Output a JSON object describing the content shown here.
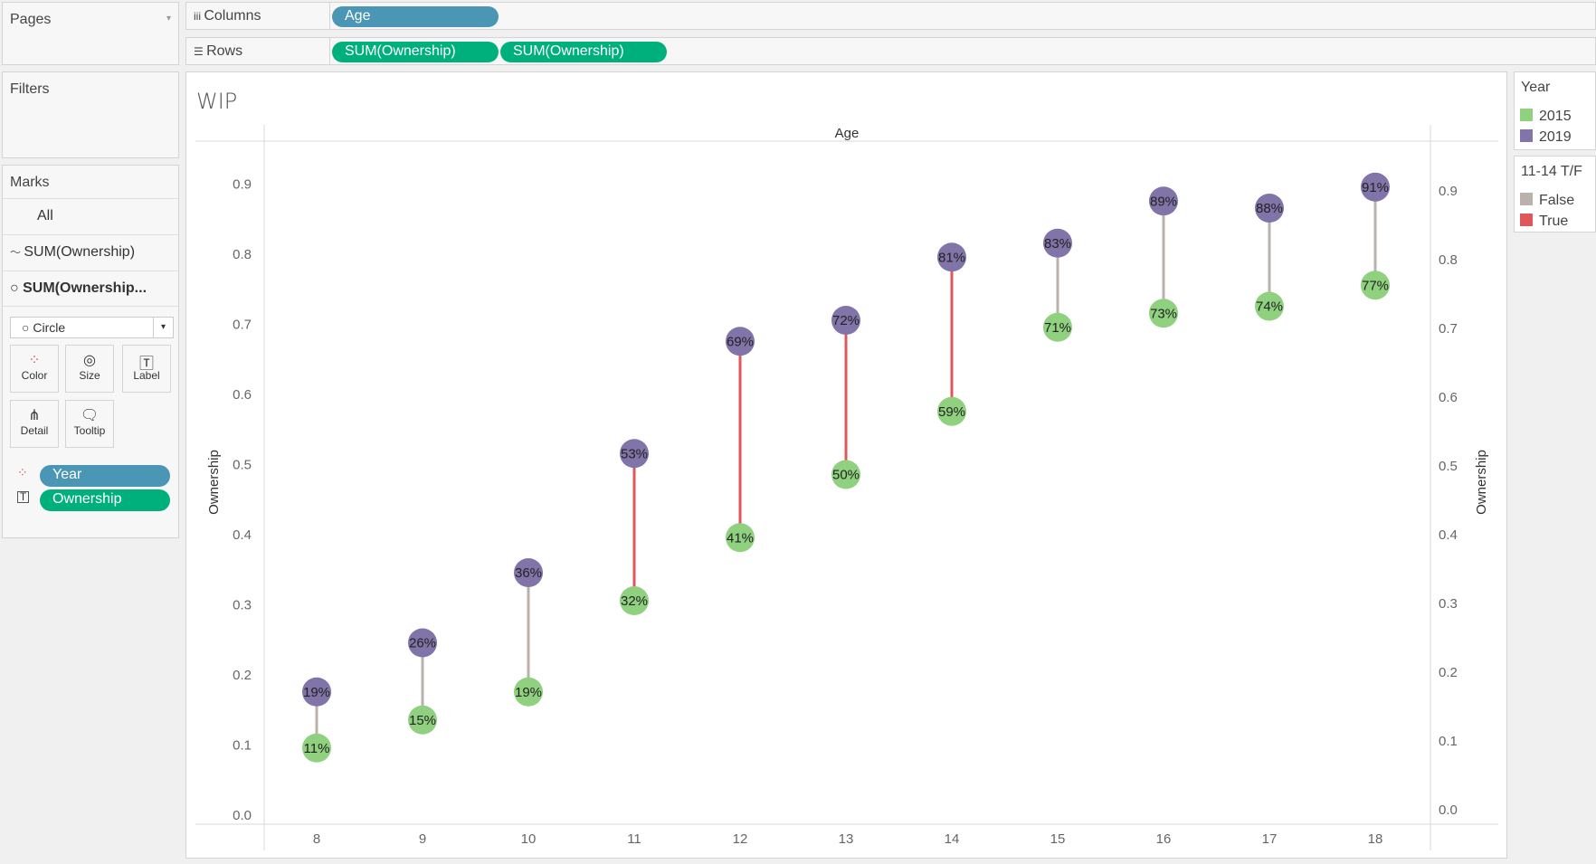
{
  "pages": {
    "title": "Pages"
  },
  "filters": {
    "title": "Filters"
  },
  "marks": {
    "title": "Marks",
    "all": "All",
    "layer1": "SUM(Ownership)",
    "layer2": "SUM(Ownership...",
    "mark_type": "Circle",
    "buttons": [
      "Color",
      "Size",
      "Label",
      "Detail",
      "Tooltip"
    ],
    "fields": [
      {
        "label": "Year",
        "kind": "color"
      },
      {
        "label": "Ownership",
        "kind": "label"
      }
    ]
  },
  "shelves": {
    "columns_label": "Columns",
    "columns": [
      "Age"
    ],
    "rows_label": "Rows",
    "rows": [
      "SUM(Ownership)",
      "SUM(Ownership)"
    ]
  },
  "legends": {
    "year": {
      "title": "Year",
      "items": [
        {
          "label": "2015",
          "color": "#8fd17f"
        },
        {
          "label": "2019",
          "color": "#8074a8"
        }
      ]
    },
    "tf": {
      "title": "11-14 T/F",
      "items": [
        {
          "label": "False",
          "color": "#bab0ac"
        },
        {
          "label": "True",
          "color": "#e15759"
        }
      ]
    }
  },
  "chart_data": {
    "type": "scatter",
    "title": "WIP",
    "xlabel": "Age",
    "ylabel": "Ownership",
    "ylabel_right": "Ownership",
    "x": [
      8,
      9,
      10,
      11,
      12,
      13,
      14,
      15,
      16,
      17,
      18
    ],
    "ylim": [
      0,
      0.95
    ],
    "yticks": [
      "0.0",
      "0.1",
      "0.2",
      "0.3",
      "0.4",
      "0.5",
      "0.6",
      "0.7",
      "0.8",
      "0.9"
    ],
    "series": [
      {
        "name": "2015",
        "color": "#8fd17f",
        "values": [
          0.11,
          0.15,
          0.19,
          0.32,
          0.41,
          0.5,
          0.59,
          0.71,
          0.73,
          0.74,
          0.77
        ],
        "labels": [
          "11%",
          "15%",
          "19%",
          "32%",
          "41%",
          "50%",
          "59%",
          "71%",
          "73%",
          "74%",
          "77%"
        ]
      },
      {
        "name": "2019",
        "color": "#8074a8",
        "values": [
          0.19,
          0.26,
          0.36,
          0.53,
          0.69,
          0.72,
          0.81,
          0.83,
          0.89,
          0.88,
          0.91
        ],
        "labels": [
          "19%",
          "26%",
          "36%",
          "53%",
          "69%",
          "72%",
          "81%",
          "83%",
          "89%",
          "88%",
          "91%"
        ]
      }
    ],
    "connector": {
      "name": "11-14 T/F",
      "values": [
        false,
        false,
        false,
        true,
        true,
        true,
        true,
        false,
        false,
        false,
        false
      ],
      "colors": {
        "false": "#bab0ac",
        "true": "#e15759"
      }
    }
  }
}
